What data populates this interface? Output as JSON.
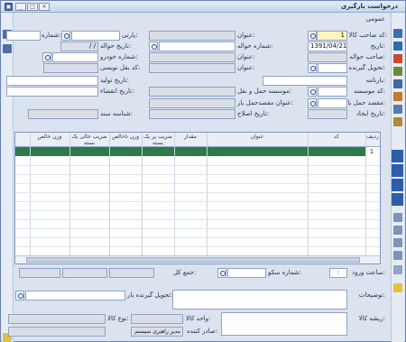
{
  "window": {
    "title": "درخواست بارگیری",
    "app_icon": "window-app-icon",
    "buttons": [
      "_",
      "□",
      "×"
    ]
  },
  "section_label": "عمومی",
  "form": {
    "code_sahebkala": {
      "label": "کد صاحب کالا:",
      "value": "1"
    },
    "onvan1": {
      "label": "عنوان:"
    },
    "parti": {
      "label": "پارتی:"
    },
    "shomareh": {
      "label": "شماره:"
    },
    "tarikh": {
      "label": "تاریخ:",
      "value": "1391/04/21"
    },
    "shomareh_havaleh": {
      "label": "شماره حواله:"
    },
    "tarikh_havaleh": {
      "label": "تاریخ حواله:",
      "value": "/ /"
    },
    "saheb_havaleh": {
      "label": "صاحب حواله:"
    },
    "onvan2": {
      "label": "عنوان:"
    },
    "shomareh_khodro": {
      "label": "شماره خودرو:"
    },
    "tahvil_girandeh": {
      "label": "تحویل گیرنده:"
    },
    "onvan3": {
      "label": "عنوان:"
    },
    "code_baqal_nevisi": {
      "label": "کد بقل نویسی:"
    },
    "barnameh": {
      "label": "بارنامه:"
    },
    "tarikh_tolid": {
      "label": "تاریخ تولید:"
    },
    "code_moasseseh": {
      "label": "کد موسسه:"
    },
    "moasseseh_haml": {
      "label": "موسسه حمل و نقل:"
    },
    "tarikh_enqeza": {
      "label": "تاریخ انقضاء:"
    },
    "maqsad_haml": {
      "label": "مقصد حمل بار:"
    },
    "onvan_maqsad": {
      "label": "عنوان مقصدحمل بار:"
    },
    "tarikh_ijad": {
      "label": "تاریخ ایجاد:"
    },
    "tarikh_eslah": {
      "label": "تاریخ اصلاح:"
    },
    "shenaseh_sanad": {
      "label": "شناسه سند:"
    }
  },
  "grid": {
    "columns": [
      "ردیف",
      "کد",
      "عنوان",
      "مقدار",
      "ضریب پر یک بسته",
      "وزن ناخالص",
      "ضریب خالی یک بسته",
      "وزن خالص"
    ],
    "first_row_num": "1"
  },
  "footer": {
    "saat_vorood": {
      "label": "ساعت ورود:",
      "value": ":"
    },
    "shomareh_sakoo": {
      "label": "شماره سکو:"
    },
    "jam_kol": {
      "label": "جمع کل:"
    },
    "tozihat": {
      "label": "توضیحات:"
    },
    "tahvil_girandeh_bar": {
      "label": "تحویل گیرنده بار:"
    },
    "risheh_kala": {
      "label": "ریشه کالا:"
    },
    "vahed_kala": {
      "label": "واحد کالا:"
    },
    "no_kala": {
      "label": "نوع کالا:"
    },
    "sader_konandeh": {
      "label": "صادر کننده:",
      "value": "مدیر راهبری سیستم"
    }
  },
  "colors": {
    "accent": "#2e7a4a",
    "window_bg": "#dbe3ef",
    "highlight": "#fff7c0"
  }
}
